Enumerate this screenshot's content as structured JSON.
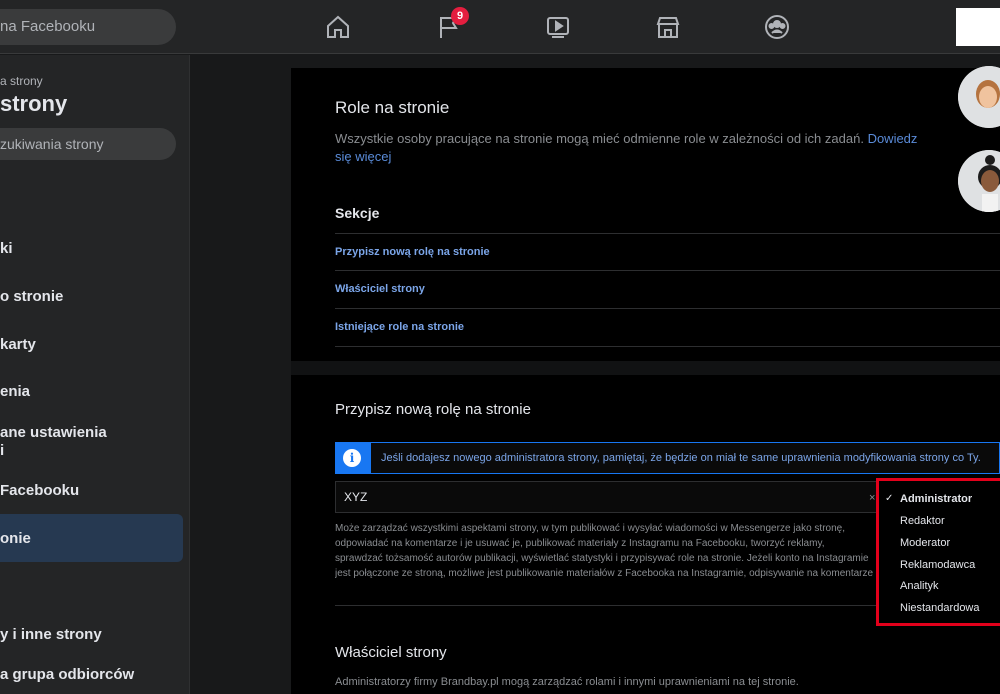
{
  "topbar": {
    "search_text": "na Facebooku",
    "notification_count": "9"
  },
  "sidebar": {
    "small_label": "a strony",
    "title": "strony",
    "search_placeholder": "zukiwania strony",
    "items": [
      {
        "label": "ki"
      },
      {
        "label": "o stronie"
      },
      {
        "label": "karty"
      },
      {
        "label": "enia"
      },
      {
        "label": "ane ustawienia"
      },
      {
        "label": "i"
      },
      {
        "label": "Facebooku"
      },
      {
        "label": "onie"
      },
      {
        "label": "y i inne strony"
      },
      {
        "label": "a grupa odbiorców"
      }
    ]
  },
  "main": {
    "title": "Role na stronie",
    "description": "Wszystkie osoby pracujące na stronie mogą mieć odmienne role w zależności od ich zadań.",
    "learn_more": "Dowiedz się więcej",
    "sections_label": "Sekcje",
    "section_links": [
      "Przypisz nową rolę na stronie",
      "Właściciel strony",
      "Istniejące role na stronie"
    ],
    "assign": {
      "title": "Przypisz nową rolę na stronie",
      "info": "Jeśli dodajesz nowego administratora strony, pamiętaj, że będzie on miał te same uprawnienia modyfikowania strony co Ty.",
      "input_value": "XYZ",
      "clear": "×",
      "permissions_text": "Może zarządzać wszystkimi aspektami strony, w tym publikować i wysyłać wiadomości w Messengerze jako stronę, odpowiadać na komentarze i je usuwać je, publikować materiały z Instagramu na Facebooku, tworzyć reklamy, sprawdzać tożsamość autorów publikacji, wyświetlać statystyki i przypisywać role na stronie. Jeżeli konto na Instagramie jest połączone ze stroną, możliwe jest publikowanie materiałów z Facebooka na Instagramie, odpisywanie na komentarze i usuwanie ich, wysyłanie wiadomości Direct, synchronizowanie informacji kontaktowych firmy."
    },
    "owner": {
      "title": "Właściciel strony",
      "description": "Administratorzy firmy Brandbay.pl mogą zarządzać rolami i innymi uprawnieniami na tej stronie."
    }
  },
  "role_dropdown": {
    "selected": "Administrator",
    "check": "✓",
    "options": [
      "Administrator",
      "Redaktor",
      "Moderator",
      "Reklamodawca",
      "Analityk",
      "Niestandardowa"
    ]
  },
  "colors": {
    "accent": "#1877f2",
    "highlight_border": "#e3001b",
    "badge": "#e41e3f"
  }
}
